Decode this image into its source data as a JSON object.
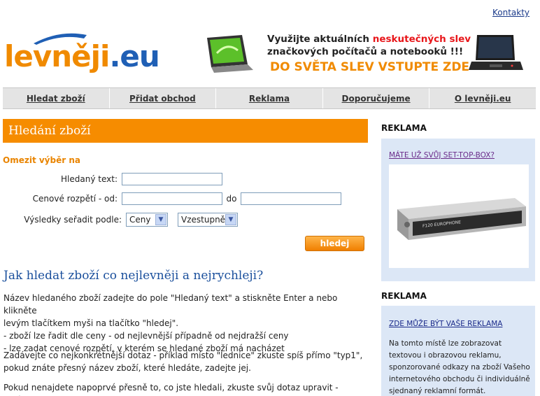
{
  "header": {
    "contacts_link": "Kontakty",
    "logo_part1": "levněji",
    "logo_part2": ".eu",
    "banner": {
      "line1_a": "Využijte aktuálních ",
      "line1_b": "neskutečných slev",
      "line2": "značkových počítačů a notebooků !!!",
      "line3": "DO SVĚTA SLEV VSTUPTE ZDE"
    }
  },
  "nav": {
    "items": [
      "Hledat zboží",
      "Přidat obchod",
      "Reklama",
      "Doporučujeme",
      "O levněji.eu"
    ]
  },
  "search": {
    "section_title": "Hledání zboží",
    "restrict_label": "Omezit výběr na",
    "query_label": "Hledaný text:",
    "query_value": "",
    "price_from_label": "Cenové rozpětí - od:",
    "price_from_value": "",
    "price_to_label": "do",
    "price_to_value": "",
    "sort_label": "Výsledky seřadit podle:",
    "sort_by_value": "Ceny",
    "sort_order_value": "Vzestupně",
    "submit_label": "hledej"
  },
  "help": {
    "title": "Jak hledat zboží co nejlevněji a nejrychleji?",
    "p1_l1": "Název hledaného zboží zadejte do pole \"Hledaný text\" a stiskněte Enter a nebo klikněte",
    "p1_l2": "levým tlačítkem myši na tlačítko \"hledej\".",
    "p1_l3": "- zboží lze řadit dle ceny - od nejlevnější případně od nejdražší ceny",
    "p1_l4": "- lze zadat cenové rozpětí, v kterém se hledané zboží má nacházet",
    "p2_l1": "Zadávejte co nejkonkrétnější dotaz - příklad místo \"lednice\" zkuste spíš přímo \"typ1\",",
    "p2_l2": "pokud znáte přesný název zboží, které hledáte, zadejte jej.",
    "p3_l1": "Pokud nenajdete napoprvé přesně to, co jste hledali, zkuste svůj dotaz upravit - zkrátit"
  },
  "sidebar": {
    "ad1_heading": "REKLAMA",
    "ad1_link": "MÁTE UŽ SVŮJ SET-TOP-BOX?",
    "ad1_device_text": "F120 EUROPHONE",
    "ad2_heading": "REKLAMA",
    "ad2_link": "ZDE MŮŽE BÝT VAŠE REKLAMA",
    "ad2_text_l1": "Na tomto místě lze zobrazovat",
    "ad2_text_l2": "textovou i obrazovou reklamu,",
    "ad2_text_l3": "sponzorované odkazy na zboží Vašeho",
    "ad2_text_l4": "internetového obchodu či individuálně",
    "ad2_text_l5": "sjednaný reklamní formát."
  },
  "colors": {
    "orange": "#f68c00",
    "blue_logo": "#1f5fb5",
    "side_box": "#dce7f6",
    "title_blue": "#1a4f9c"
  }
}
